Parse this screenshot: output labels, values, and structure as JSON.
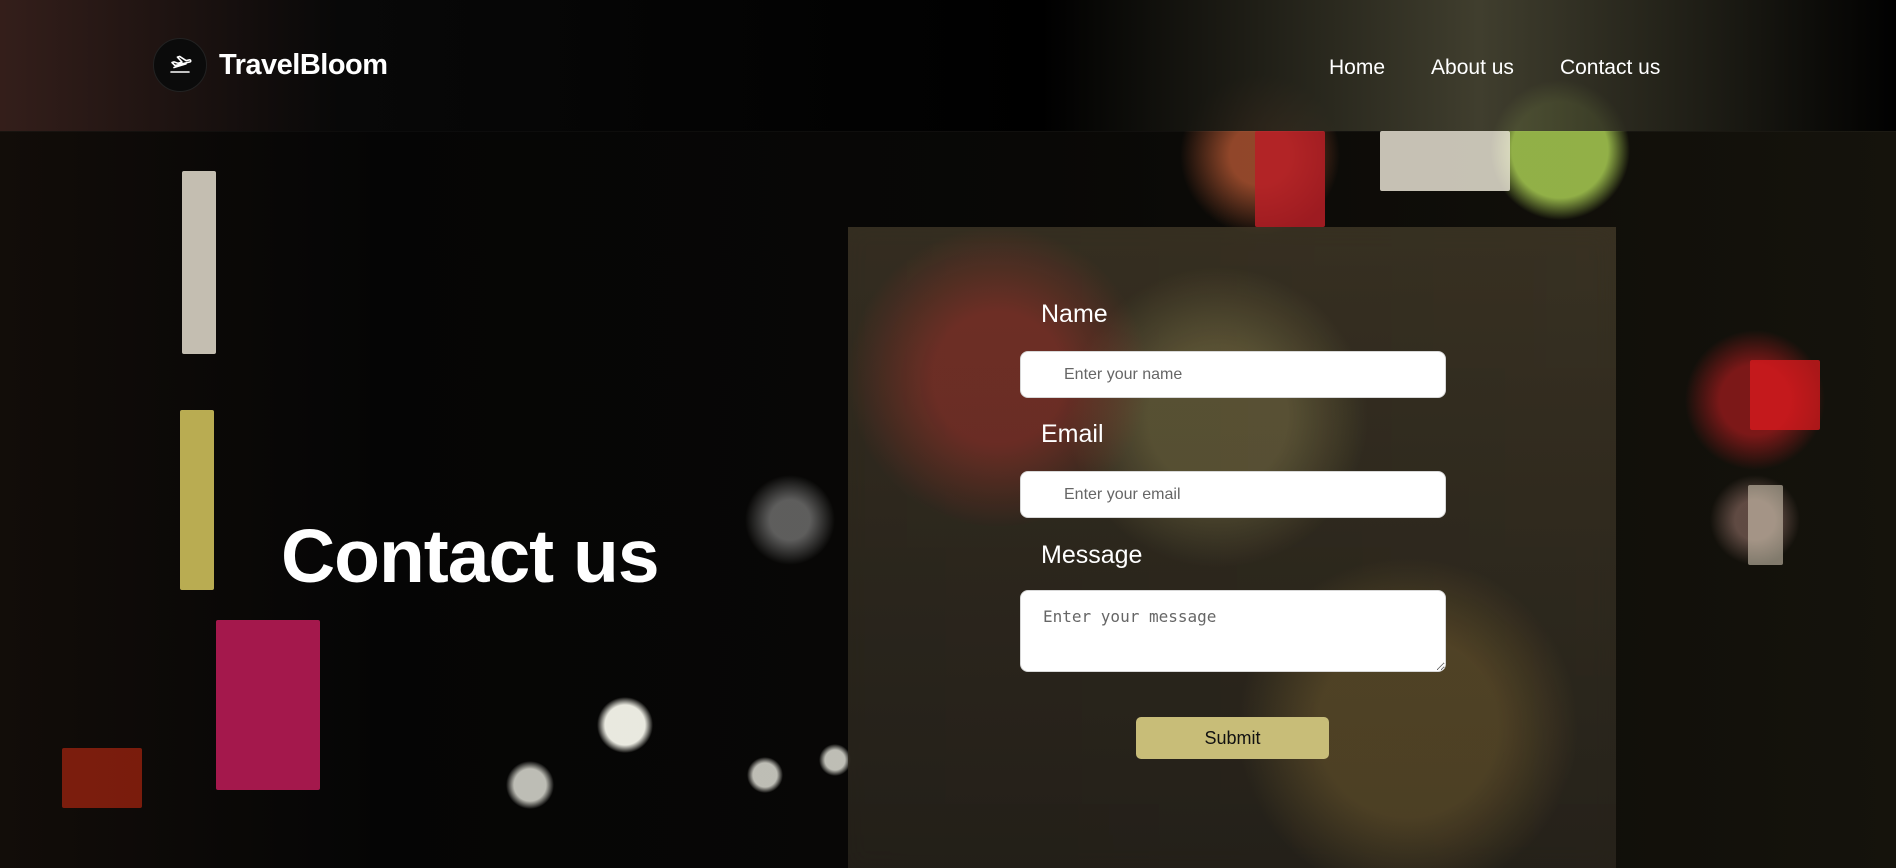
{
  "brand": {
    "name": "TravelBloom",
    "icon": "airplane-landing-icon"
  },
  "nav": [
    {
      "label": "Home"
    },
    {
      "label": "About us"
    },
    {
      "label": "Contact us"
    }
  ],
  "hero": {
    "title": "Contact us"
  },
  "form": {
    "name": {
      "label": "Name",
      "placeholder": "Enter your name",
      "value": ""
    },
    "email": {
      "label": "Email",
      "placeholder": "Enter your email",
      "value": ""
    },
    "message": {
      "label": "Message",
      "placeholder": "Enter your message",
      "value": ""
    },
    "submit_label": "Submit"
  },
  "colors": {
    "submit_button": "#c8bd78",
    "header_background": "#000000",
    "text": "#ffffff"
  }
}
